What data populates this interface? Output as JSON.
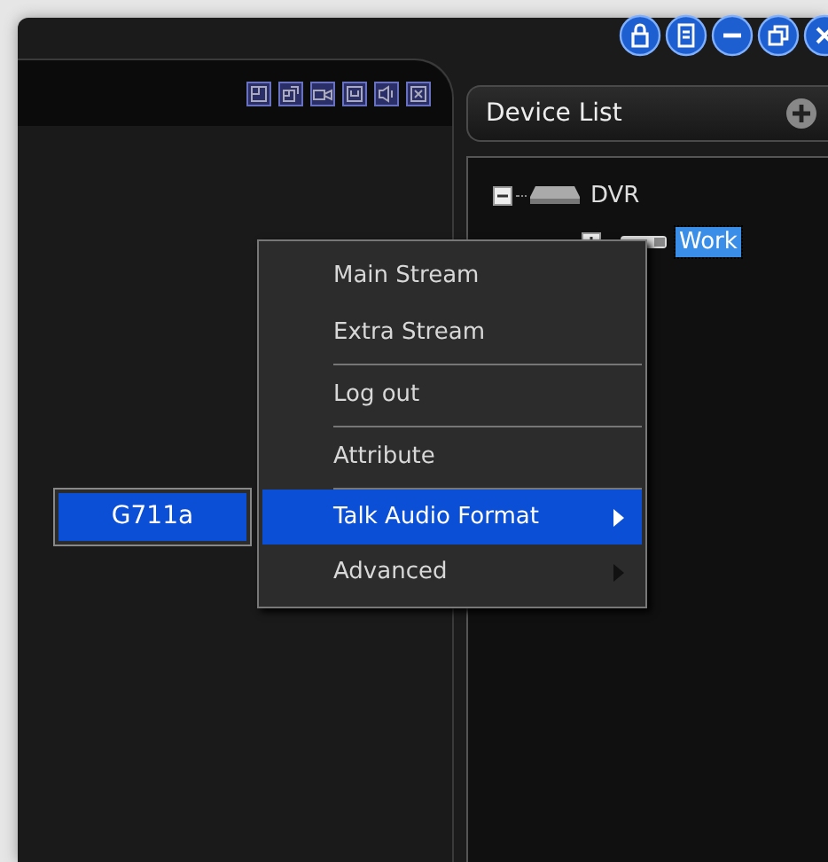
{
  "device_list": {
    "title": "Device List",
    "tree": [
      {
        "label": "DVR",
        "expanded": true,
        "selected": false,
        "children": [
          {
            "label": "Work",
            "expanded": false,
            "selected": true
          }
        ]
      }
    ]
  },
  "context_menu": {
    "items": [
      {
        "label": "Main Stream",
        "selected": false,
        "has_submenu": false,
        "separator_after": false
      },
      {
        "label": "Extra Stream",
        "selected": false,
        "has_submenu": false,
        "separator_after": true
      },
      {
        "label": "Log out",
        "selected": false,
        "has_submenu": false,
        "separator_after": true
      },
      {
        "label": "Attribute",
        "selected": false,
        "has_submenu": false,
        "separator_after": true
      },
      {
        "label": "Talk Audio Format",
        "selected": true,
        "has_submenu": true,
        "separator_after": false
      },
      {
        "label": "Advanced",
        "selected": false,
        "has_submenu": true,
        "separator_after": false
      }
    ]
  },
  "submenu": {
    "items": [
      {
        "label": "G711a",
        "selected": true
      }
    ]
  }
}
